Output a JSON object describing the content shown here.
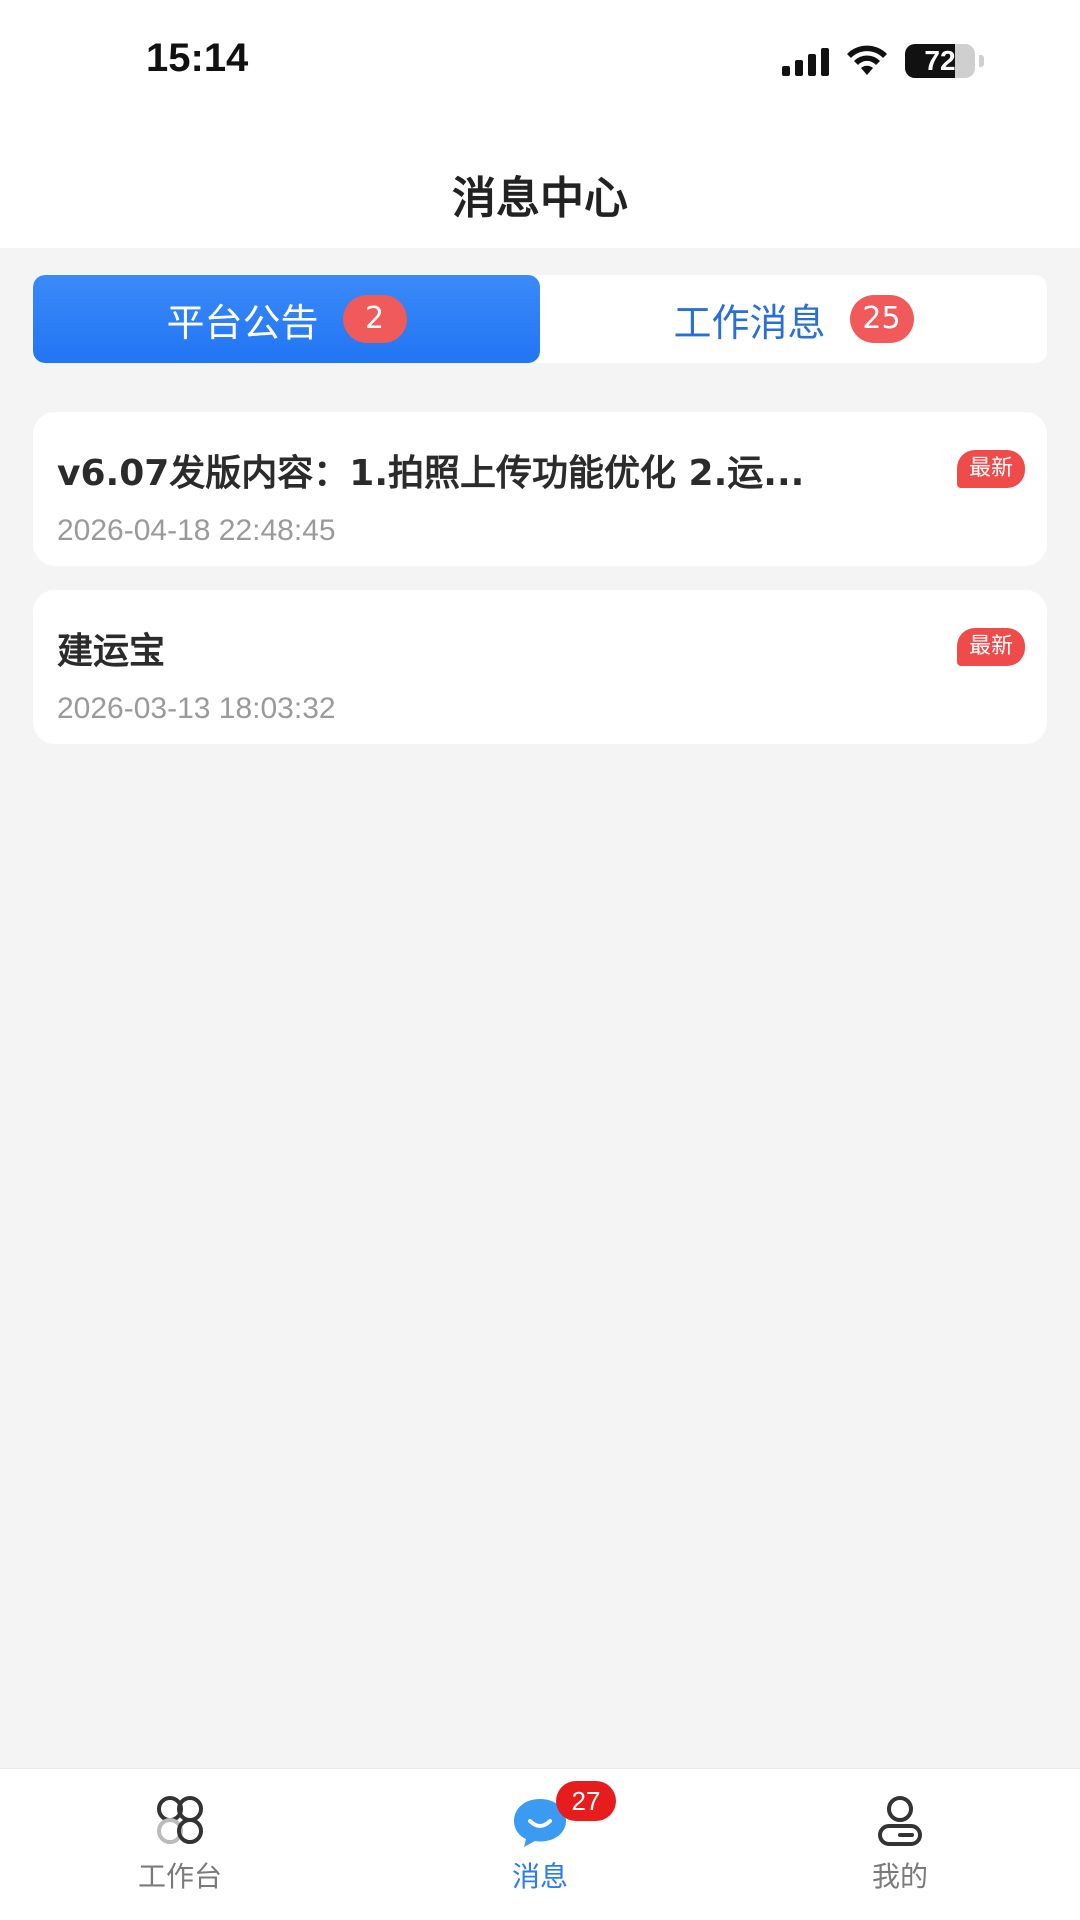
{
  "status_bar": {
    "time": "15:14",
    "battery_level": "72",
    "icons": [
      "signal-icon",
      "wifi-icon",
      "battery-icon"
    ]
  },
  "header": {
    "title": "消息中心"
  },
  "tabs": [
    {
      "label": "平台公告",
      "count": "2",
      "active": true
    },
    {
      "label": "工作消息",
      "count": "25",
      "active": false
    }
  ],
  "notices": [
    {
      "title": "v6.07发版内容：1.拍照上传功能优化 2.运...",
      "time": "2026-04-18 22:48:45",
      "badge": "最新"
    },
    {
      "title": "建运宝",
      "time": "2026-03-13 18:03:32",
      "badge": "最新"
    }
  ],
  "tabbar": {
    "items": [
      {
        "label": "工作台",
        "icon": "workbench-icon"
      },
      {
        "label": "消息",
        "icon": "message-icon",
        "badge": "27",
        "active": true
      },
      {
        "label": "我的",
        "icon": "profile-icon"
      }
    ]
  },
  "colors": {
    "accent": "#2275f4",
    "badge_red": "#ef4b4b",
    "background": "#f4f4f5"
  }
}
